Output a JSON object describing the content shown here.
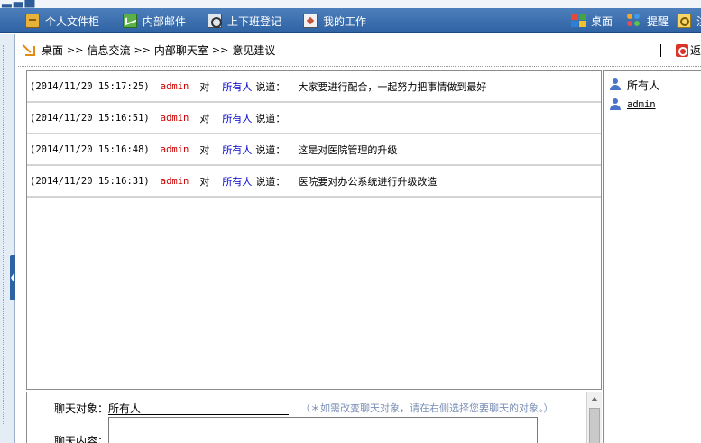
{
  "nav": {
    "left": [
      {
        "label": "个人文件柜",
        "icon": "file-cabinet-icon"
      },
      {
        "label": "内部邮件",
        "icon": "mail-icon"
      },
      {
        "label": "上下班登记",
        "icon": "attendance-icon"
      },
      {
        "label": "我的工作",
        "icon": "work-icon"
      }
    ],
    "right": [
      {
        "label": "桌面",
        "icon": "desktop-icon"
      },
      {
        "label": "提醒",
        "icon": "remind-icon"
      },
      {
        "label": "注",
        "icon": "key-icon"
      }
    ],
    "bar_color": "#2f62a3"
  },
  "breadcrumb": {
    "items": [
      "桌面",
      "信息交流",
      "内部聊天室",
      "意见建议"
    ],
    "separator": ">>",
    "back_label": "返"
  },
  "messages": [
    {
      "time": "(2014/11/20 15:17:25)",
      "from": "admin",
      "verb": "对",
      "to": "所有人",
      "said": "说道：",
      "text": "大家要进行配合，一起努力把事情做到最好"
    },
    {
      "time": "(2014/11/20 15:16:51)",
      "from": "admin",
      "verb": "对",
      "to": "所有人",
      "said": "说道：",
      "text": ""
    },
    {
      "time": "(2014/11/20 15:16:48)",
      "from": "admin",
      "verb": "对",
      "to": "所有人",
      "said": "说道：",
      "text": "这是对医院管理的升级"
    },
    {
      "time": "(2014/11/20 15:16:31)",
      "from": "admin",
      "verb": "对",
      "to": "所有人",
      "said": "说道：",
      "text": "医院要对办公系统进行升级改造"
    }
  ],
  "users": [
    {
      "name": "所有人"
    },
    {
      "name": "admin"
    }
  ],
  "form": {
    "target_label": "聊天对象：",
    "target_value": "所有人",
    "hint": "（＊如需改变聊天对象，请在右侧选择您要聊天的对象。）",
    "content_label": "聊天内容："
  },
  "colors": {
    "sender": "#cc0000",
    "recipient": "#0000cc",
    "hint": "#7a8fb5"
  }
}
